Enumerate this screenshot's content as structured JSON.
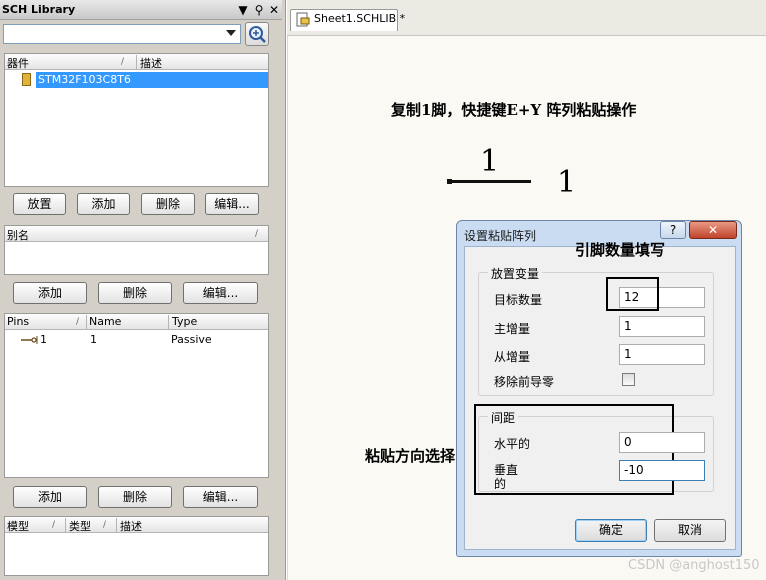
{
  "panel": {
    "title": "SCH Library",
    "component_list": {
      "col_component": "器件",
      "col_description": "描述",
      "items": [
        {
          "name": "STM32F103C8T6",
          "description": ""
        }
      ]
    },
    "component_buttons": {
      "place": "放置",
      "add": "添加",
      "delete": "删除",
      "edit": "编辑..."
    },
    "alias_list": {
      "col_alias": "别名"
    },
    "alias_buttons": {
      "add": "添加",
      "delete": "删除",
      "edit": "编辑..."
    },
    "pins_list": {
      "col_pins": "Pins",
      "col_name": "Name",
      "col_type": "Type",
      "rows": [
        {
          "pin": "1",
          "name": "1",
          "type": "Passive"
        }
      ]
    },
    "pin_buttons": {
      "add": "添加",
      "delete": "删除",
      "edit": "编辑..."
    },
    "model_list": {
      "col_model": "模型",
      "col_type": "类型",
      "col_description": "描述"
    }
  },
  "document_tab": {
    "label": "Sheet1.SCHLIB *"
  },
  "canvas": {
    "instruction": "复制1脚，快捷键E+Y 阵列粘贴操作",
    "pin_name": "1",
    "pin_number": "1",
    "callout_pin_count": "引脚数量填写",
    "callout_direction": "粘贴方向选择"
  },
  "dialog": {
    "title": "设置粘贴阵列",
    "help_label": "?",
    "close_label": "✕",
    "group_placement": "放置变量",
    "target_count_label": "目标数量",
    "target_count_value": "12",
    "primary_increment_label": "主增量",
    "primary_increment_value": "1",
    "secondary_increment_label": "从增量",
    "secondary_increment_value": "1",
    "remove_leading_zeros_label": "移除前导零",
    "group_spacing": "间距",
    "horizontal_label": "水平的",
    "horizontal_value": "0",
    "vertical_label_line1": "垂直",
    "vertical_label_line2": "的",
    "vertical_value": "-10",
    "ok_label": "确定",
    "cancel_label": "取消"
  },
  "watermark": "CSDN @anghost150"
}
